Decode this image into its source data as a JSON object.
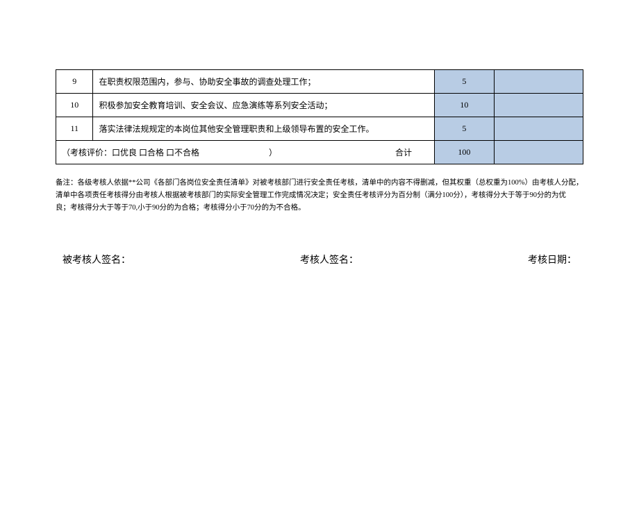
{
  "table": {
    "rows": [
      {
        "num": "9",
        "desc": "在职责权限范围内，参与、协助安全事故的调查处理工作；",
        "score": "5"
      },
      {
        "num": "10",
        "desc": "积极参加安全教育培训、安全会议、应急演练等系列安全活动；",
        "score": "10"
      },
      {
        "num": "11",
        "desc": "落实法律法规规定的本岗位其他安全管理职责和上级领导布置的安全工作。",
        "score": "5"
      }
    ],
    "summary": {
      "label_left": "（考核评价：口优良 口合格 口不合格",
      "label_paren": "）",
      "label_right": "合计",
      "total": "100"
    }
  },
  "notes": {
    "line1": "备注：各级考核人依据**公司《各部门各岗位安全责任清单》对被考核部门进行安全责任考核，清单中的内容不得删减，但其权重（总权重为100%）由考核人分配，",
    "line2": "清单中各项责任考核得分由考核人根据被考核部门的实际安全管理工作完成情况决定；安全责任考核评分为百分制（满分100分），考核得分大于等于90分的为优",
    "line3": "良；考核得分大于等于70,小于90分的为合格；考核得分小于70分的为不合格。"
  },
  "signatures": {
    "examinee": "被考核人签名：",
    "examiner": "考核人签名：",
    "date": "考核日期："
  }
}
